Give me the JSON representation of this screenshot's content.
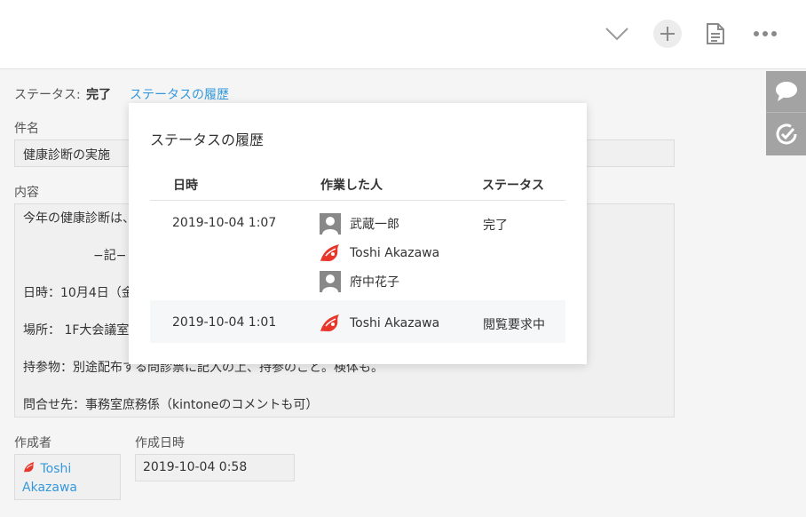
{
  "toolbar": {
    "icons": [
      "chevron-down-icon",
      "plus-icon",
      "document-icon",
      "more-icon"
    ]
  },
  "side_panel": {
    "icons": [
      "comment-icon",
      "history-icon"
    ]
  },
  "status": {
    "label": "ステータス:",
    "value": "完了",
    "history_link": "ステータスの履歴"
  },
  "fields": {
    "subject_label": "件名",
    "subject_value": "健康診断の実施",
    "content_label": "内容",
    "content_lines": [
      "今年の健康診断は、",
      "−記−",
      "日時：10月4日（金",
      "場所：  1F大会議室",
      "持参物：別途配布する問診票に記入の上、持参のこと。検体も。",
      "問合せ先：事務室庶務係（kintoneのコメントも可）"
    ],
    "creator_label": "作成者",
    "creator_value": "Toshi Akazawa",
    "created_label": "作成日時",
    "created_value": "2019-10-04 0:58"
  },
  "history_popup": {
    "title": "ステータスの履歴",
    "headers": [
      "日時",
      "作業した人",
      "ステータス"
    ],
    "rows": [
      {
        "datetime": "2019-10-04 1:07",
        "users": [
          {
            "name": "武蔵一郎",
            "avatar": "default"
          },
          {
            "name": "Toshi Akazawa",
            "avatar": "custom"
          },
          {
            "name": "府中花子",
            "avatar": "default"
          }
        ],
        "status": "完了"
      },
      {
        "datetime": "2019-10-04 1:01",
        "users": [
          {
            "name": "Toshi Akazawa",
            "avatar": "custom"
          }
        ],
        "status": "閲覧要求中"
      }
    ]
  },
  "colors": {
    "link": "#3498db",
    "panel": "#a3a3a3"
  }
}
